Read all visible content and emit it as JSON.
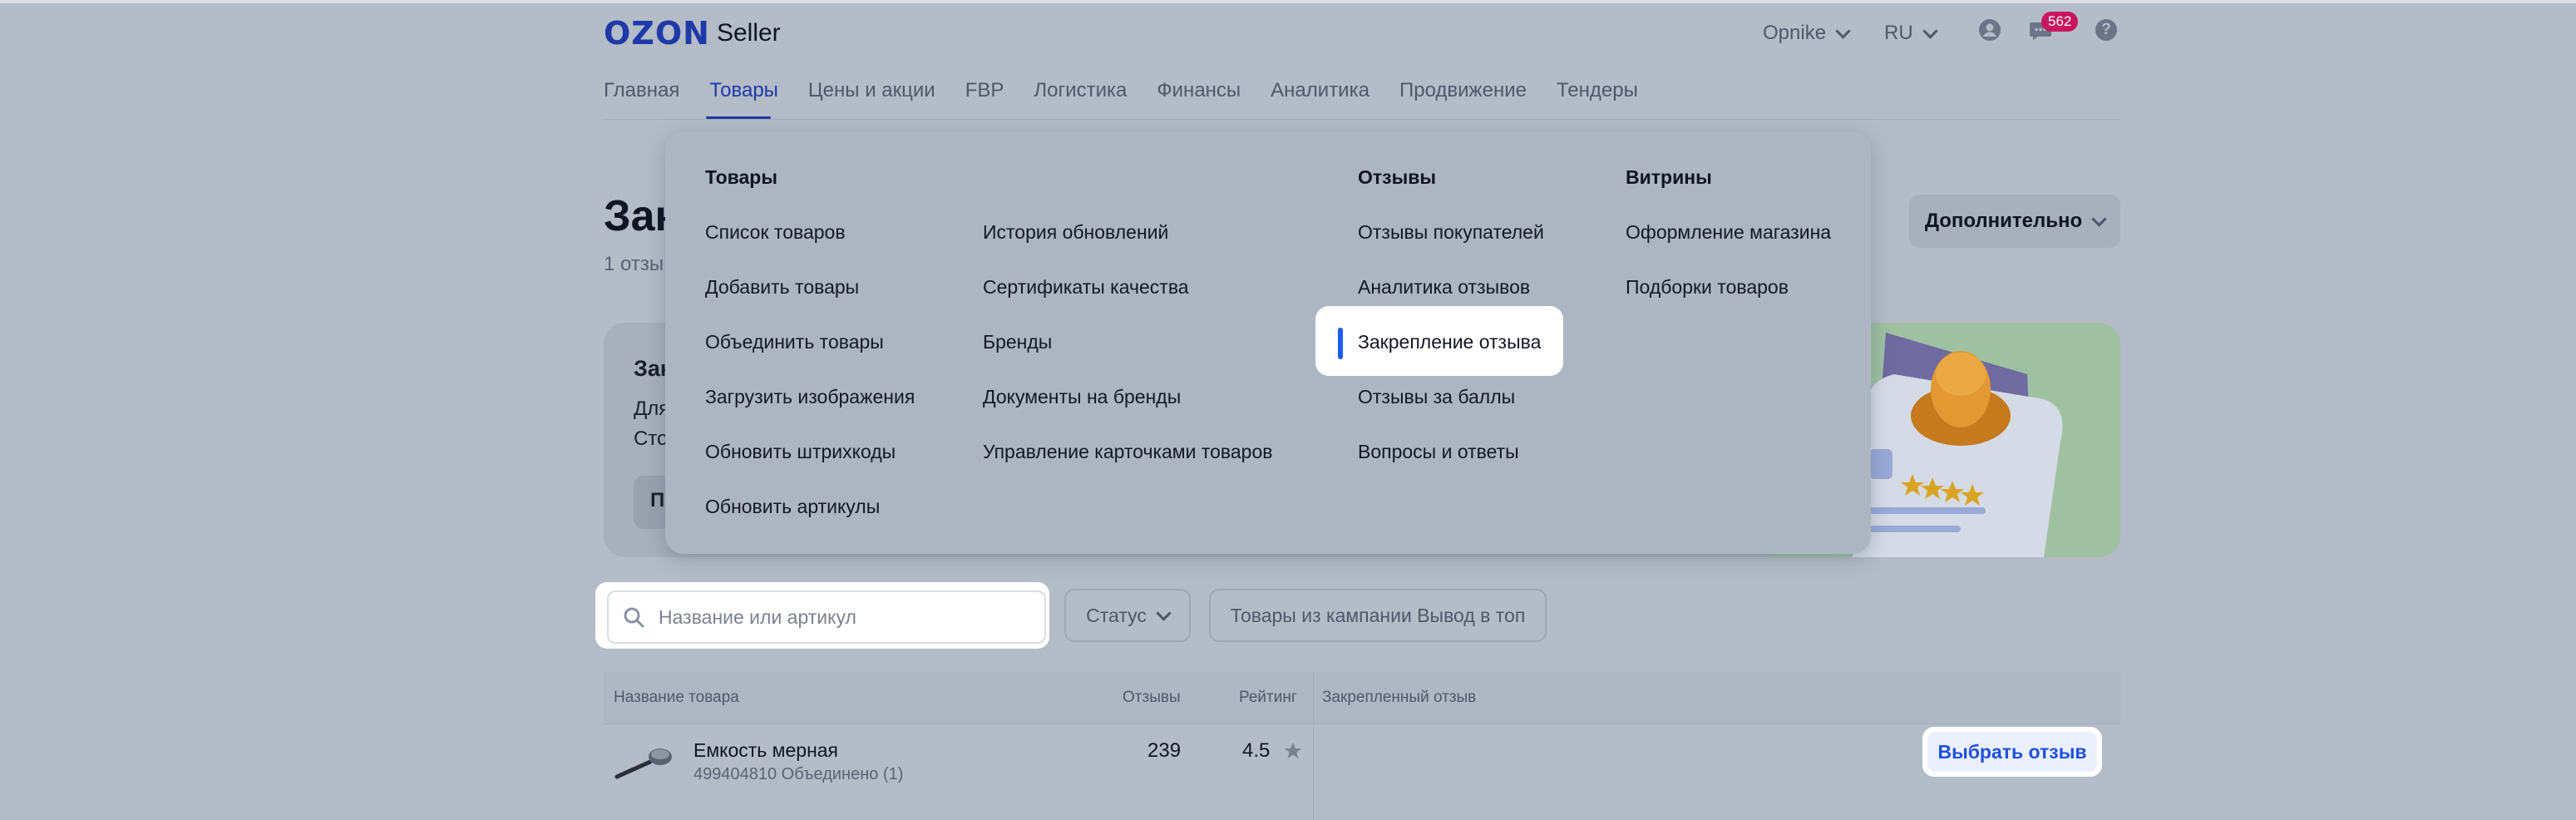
{
  "header": {
    "brand": "OZON",
    "product": "Seller",
    "company": "Opnike",
    "language": "RU",
    "notifications_count": "562",
    "help_glyph": "?",
    "icons": [
      "user-icon",
      "chat-icon",
      "help-icon",
      "search-icon",
      "chevron-down-icon",
      "star-icon"
    ]
  },
  "nav": {
    "items": [
      "Главная",
      "Товары",
      "Цены и акции",
      "FBP",
      "Логистика",
      "Финансы",
      "Аналитика",
      "Продвижение",
      "Тендеры"
    ],
    "active": "Товары"
  },
  "page": {
    "title_fragment": "Зак",
    "subtitle_fragment": "1 отзы",
    "more_button": "Дополнительно",
    "banner": {
      "title_fragment": "Зак",
      "line1_fragment": "Для",
      "line2_fragment": "Сто",
      "button_fragment": "П"
    }
  },
  "dropdown": {
    "products": {
      "heading": "Товары",
      "col1": [
        "Список товаров",
        "Добавить товары",
        "Объединить товары",
        "Загрузить изображения",
        "Обновить штрихкоды",
        "Обновить артикулы"
      ],
      "col2": [
        "История обновлений",
        "Сертификаты качества",
        "Бренды",
        "Документы на бренды",
        "Управление карточками товаров"
      ]
    },
    "reviews": {
      "heading": "Отзывы",
      "items": [
        "Отзывы покупателей",
        "Аналитика отзывов",
        "Закрепление отзыва",
        "Отзывы за баллы",
        "Вопросы и ответы"
      ],
      "selected": "Закрепление отзыва"
    },
    "showcases": {
      "heading": "Витрины",
      "items": [
        "Оформление магазина",
        "Подборки товаров"
      ]
    }
  },
  "filters": {
    "search_placeholder": "Название или артикул",
    "search_value": "",
    "status_label": "Статус",
    "campaign_label": "Товары из кампании Вывод в топ"
  },
  "table": {
    "headers": {
      "name": "Название товара",
      "reviews": "Отзывы",
      "rating": "Рейтинг",
      "pinned": "Закрепленный отзыв"
    },
    "rows": [
      {
        "name": "Емкость мерная",
        "meta": "499404810 Объединено (1)",
        "reviews": "239",
        "rating": "4.5",
        "action": "Выбрать отзыв"
      }
    ]
  }
}
